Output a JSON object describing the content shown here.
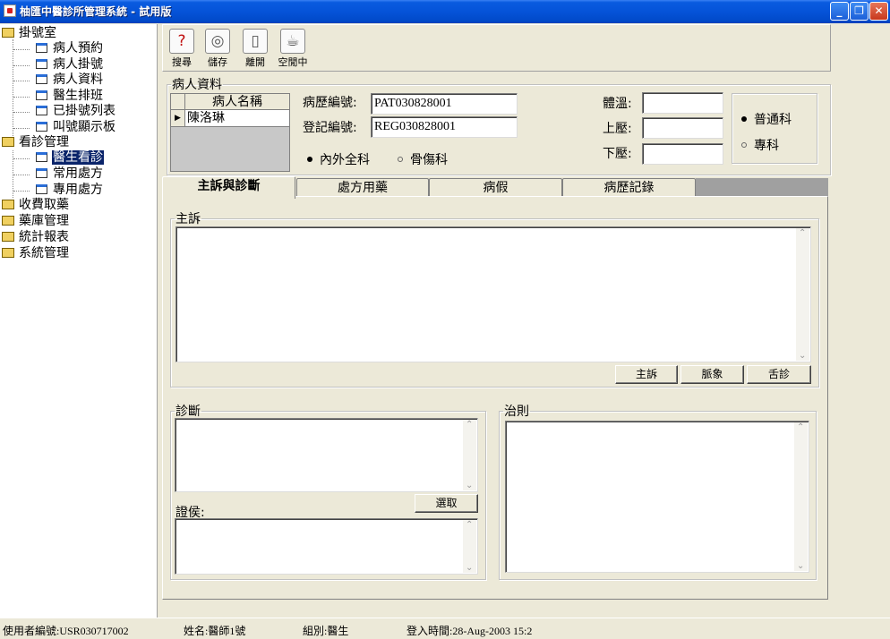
{
  "window": {
    "title": "柚匯中醫診所管理系統 - 試用版",
    "minimize": "_",
    "restore": "❐",
    "close": "✕"
  },
  "sidebar": {
    "groups": [
      {
        "label": "掛號室",
        "items": [
          "病人預約",
          "病人掛號",
          "病人資料",
          "醫生排班",
          "已掛號列表",
          "叫號顯示板"
        ]
      },
      {
        "label": "看診管理",
        "items": [
          "醫生看診",
          "常用處方",
          "專用處方"
        ],
        "selected": "醫生看診"
      },
      {
        "label": "收費取藥"
      },
      {
        "label": "藥庫管理"
      },
      {
        "label": "統計報表"
      },
      {
        "label": "系統管理"
      }
    ]
  },
  "toolbar": {
    "search": "搜尋",
    "save": "儲存",
    "leave": "離開",
    "idle": "空閒中"
  },
  "patient": {
    "section_title": "病人資料",
    "grid_header": "病人名稱",
    "patient_name": "陳洛琳",
    "record_no_label": "病歷編號:",
    "record_no": "PAT030828001",
    "reg_no_label": "登記編號:",
    "reg_no": "REG030828001",
    "temp_label": "體溫:",
    "temp": "",
    "upper_bp_label": "上壓:",
    "upper_bp": "",
    "lower_bp_label": "下壓:",
    "lower_bp": "",
    "dept_options": [
      "內外全科",
      "骨傷科"
    ],
    "dept_selected": "內外全科",
    "type_options": [
      "普通科",
      "專科"
    ],
    "type_selected": "普通科"
  },
  "tabs": [
    "主訴與診斷",
    "處方用藥",
    "病假",
    "病歷記錄"
  ],
  "active_tab": "主訴與診斷",
  "complaint": {
    "title": "主訴",
    "buttons": [
      "主訴",
      "脈象",
      "舌診"
    ]
  },
  "diagnosis": {
    "title": "診斷",
    "syndrome_label": "證侯:",
    "select_button": "選取"
  },
  "treatment": {
    "title": "治則"
  },
  "status": {
    "user_id": "使用者編號:USR030717002",
    "name": "姓名:醫師1號",
    "group": "組別:醫生",
    "login_time": "登入時間:28-Aug-2003 15:2"
  }
}
